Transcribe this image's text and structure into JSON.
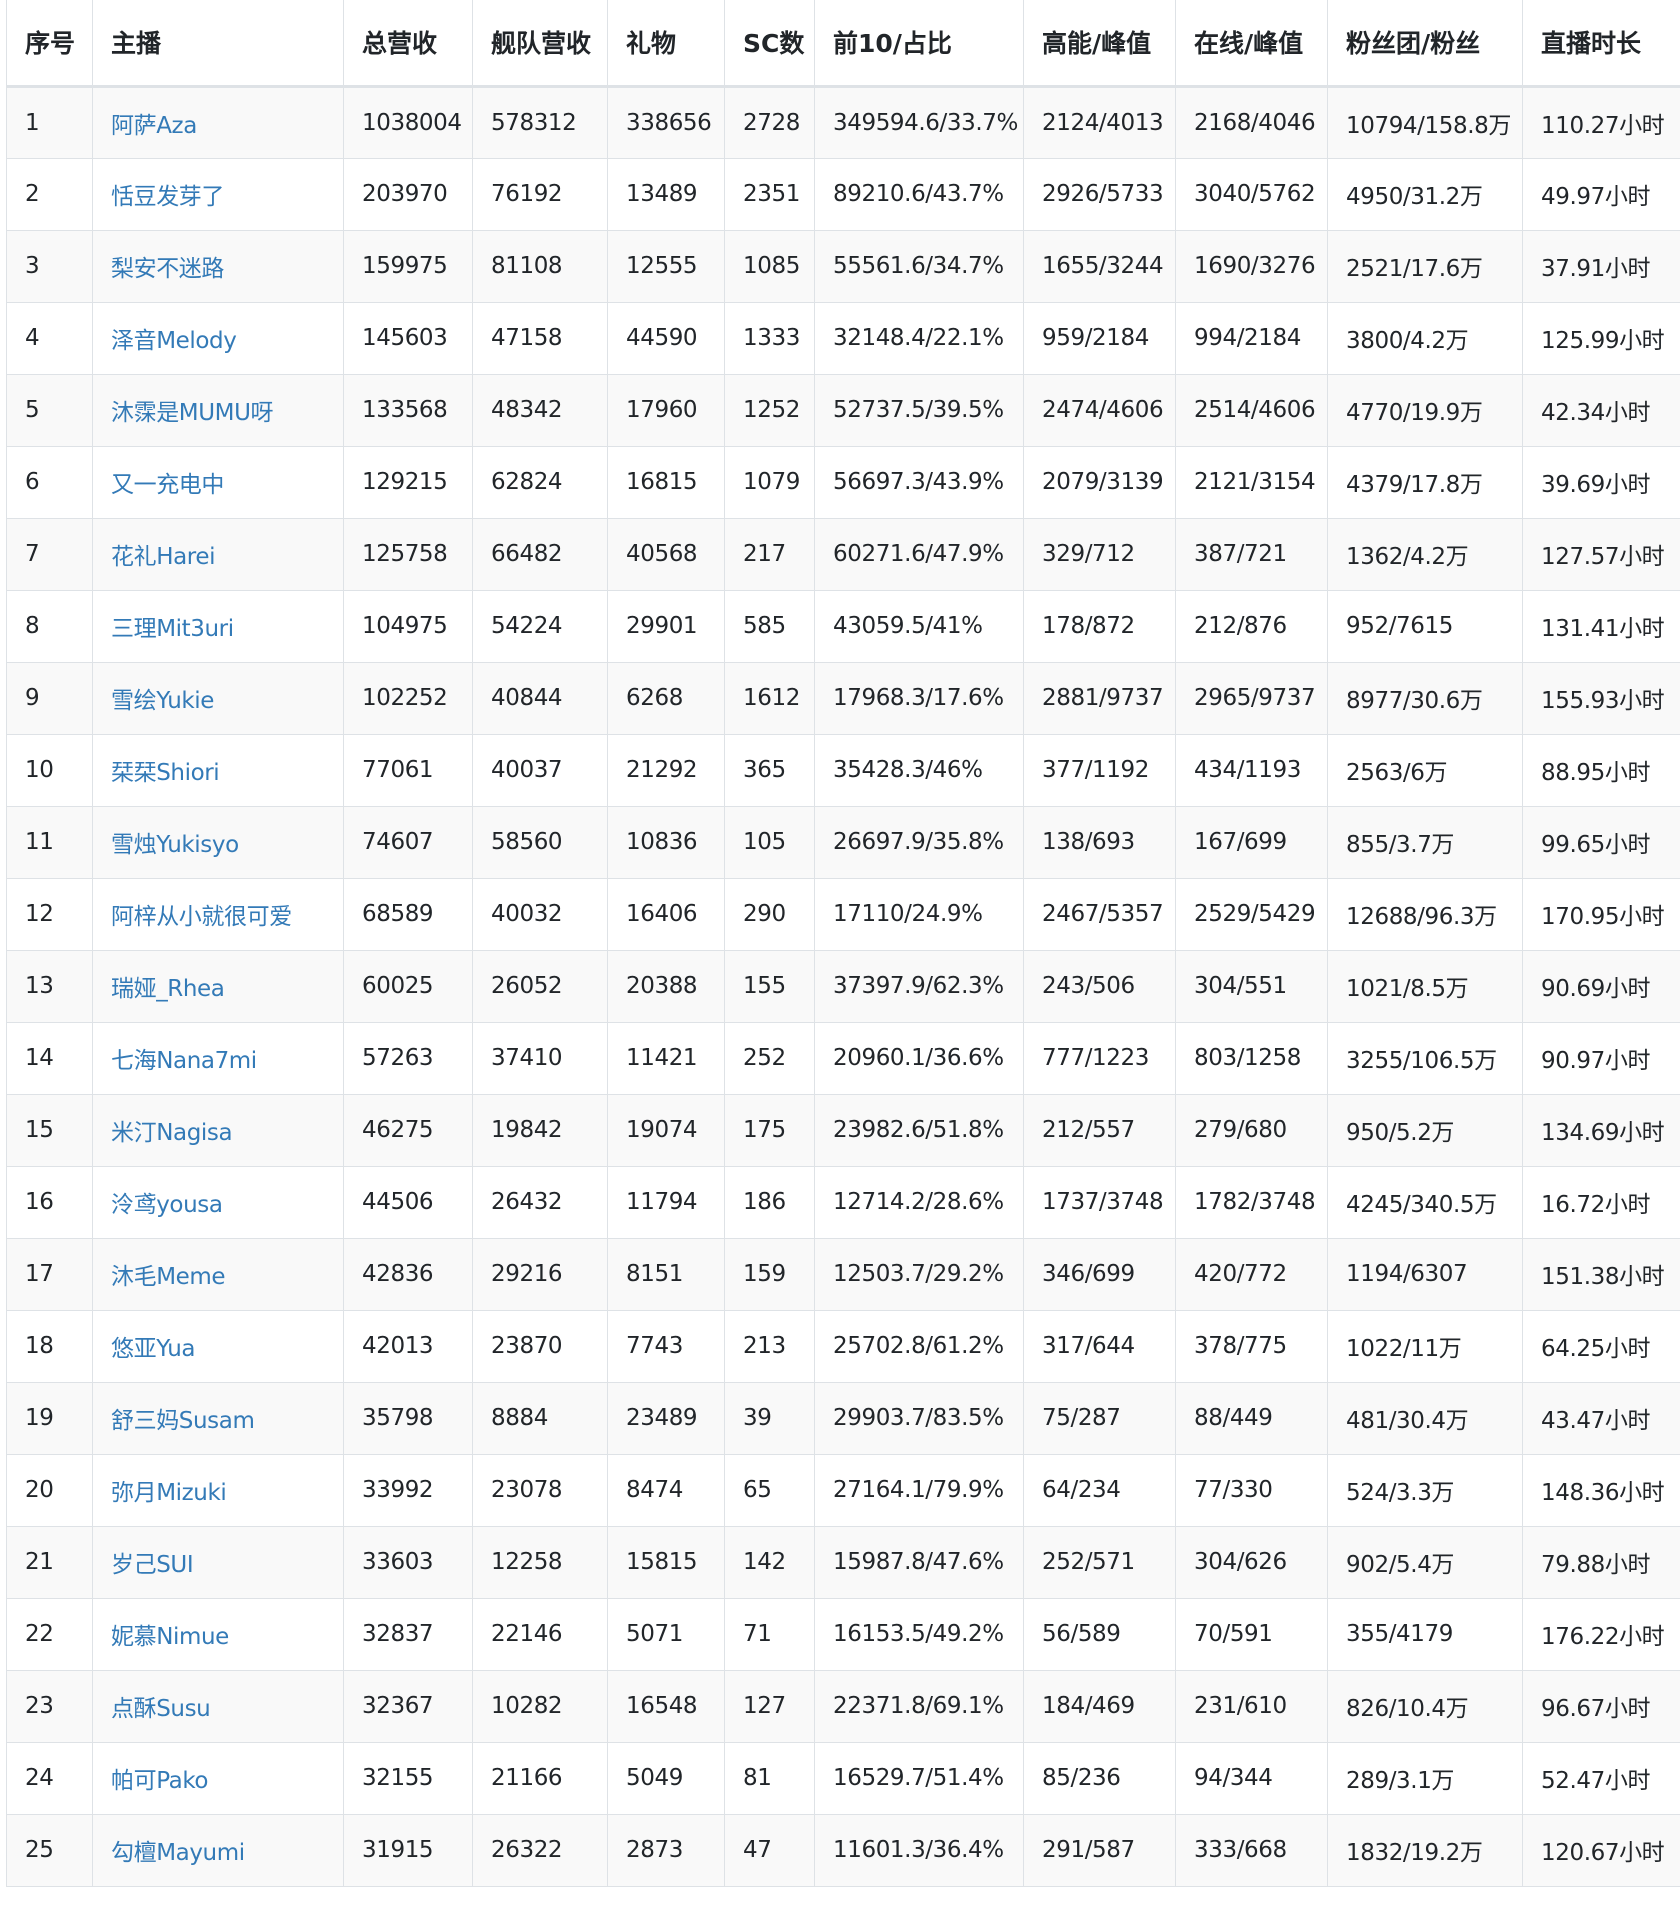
{
  "table": {
    "headers": [
      "序号",
      "主播",
      "总营收",
      "舰队营收",
      "礼物",
      "SC数",
      "前10/占比",
      "高能/峰值",
      "在线/峰值",
      "粉丝团/粉丝",
      "直播时长"
    ],
    "link_color": "#337ab7",
    "rows": [
      [
        "1",
        "阿萨Aza",
        "1038004",
        "578312",
        "338656",
        "2728",
        "349594.6/33.7%",
        "2124/4013",
        "2168/4046",
        "10794/158.8万",
        "110.27小时"
      ],
      [
        "2",
        "恬豆发芽了",
        "203970",
        "76192",
        "13489",
        "2351",
        "89210.6/43.7%",
        "2926/5733",
        "3040/5762",
        "4950/31.2万",
        "49.97小时"
      ],
      [
        "3",
        "梨安不迷路",
        "159975",
        "81108",
        "12555",
        "1085",
        "55561.6/34.7%",
        "1655/3244",
        "1690/3276",
        "2521/17.6万",
        "37.91小时"
      ],
      [
        "4",
        "泽音Melody",
        "145603",
        "47158",
        "44590",
        "1333",
        "32148.4/22.1%",
        "959/2184",
        "994/2184",
        "3800/4.2万",
        "125.99小时"
      ],
      [
        "5",
        "沐霂是MUMU呀",
        "133568",
        "48342",
        "17960",
        "1252",
        "52737.5/39.5%",
        "2474/4606",
        "2514/4606",
        "4770/19.9万",
        "42.34小时"
      ],
      [
        "6",
        "又一充电中",
        "129215",
        "62824",
        "16815",
        "1079",
        "56697.3/43.9%",
        "2079/3139",
        "2121/3154",
        "4379/17.8万",
        "39.69小时"
      ],
      [
        "7",
        "花礼Harei",
        "125758",
        "66482",
        "40568",
        "217",
        "60271.6/47.9%",
        "329/712",
        "387/721",
        "1362/4.2万",
        "127.57小时"
      ],
      [
        "8",
        "三理Mit3uri",
        "104975",
        "54224",
        "29901",
        "585",
        "43059.5/41%",
        "178/872",
        "212/876",
        "952/7615",
        "131.41小时"
      ],
      [
        "9",
        "雪绘Yukie",
        "102252",
        "40844",
        "6268",
        "1612",
        "17968.3/17.6%",
        "2881/9737",
        "2965/9737",
        "8977/30.6万",
        "155.93小时"
      ],
      [
        "10",
        "栞栞Shiori",
        "77061",
        "40037",
        "21292",
        "365",
        "35428.3/46%",
        "377/1192",
        "434/1193",
        "2563/6万",
        "88.95小时"
      ],
      [
        "11",
        "雪烛Yukisyo",
        "74607",
        "58560",
        "10836",
        "105",
        "26697.9/35.8%",
        "138/693",
        "167/699",
        "855/3.7万",
        "99.65小时"
      ],
      [
        "12",
        "阿梓从小就很可爱",
        "68589",
        "40032",
        "16406",
        "290",
        "17110/24.9%",
        "2467/5357",
        "2529/5429",
        "12688/96.3万",
        "170.95小时"
      ],
      [
        "13",
        "瑞娅_Rhea",
        "60025",
        "26052",
        "20388",
        "155",
        "37397.9/62.3%",
        "243/506",
        "304/551",
        "1021/8.5万",
        "90.69小时"
      ],
      [
        "14",
        "七海Nana7mi",
        "57263",
        "37410",
        "11421",
        "252",
        "20960.1/36.6%",
        "777/1223",
        "803/1258",
        "3255/106.5万",
        "90.97小时"
      ],
      [
        "15",
        "米汀Nagisa",
        "46275",
        "19842",
        "19074",
        "175",
        "23982.6/51.8%",
        "212/557",
        "279/680",
        "950/5.2万",
        "134.69小时"
      ],
      [
        "16",
        "泠鸢yousa",
        "44506",
        "26432",
        "11794",
        "186",
        "12714.2/28.6%",
        "1737/3748",
        "1782/3748",
        "4245/340.5万",
        "16.72小时"
      ],
      [
        "17",
        "沐毛Meme",
        "42836",
        "29216",
        "8151",
        "159",
        "12503.7/29.2%",
        "346/699",
        "420/772",
        "1194/6307",
        "151.38小时"
      ],
      [
        "18",
        "悠亚Yua",
        "42013",
        "23870",
        "7743",
        "213",
        "25702.8/61.2%",
        "317/644",
        "378/775",
        "1022/11万",
        "64.25小时"
      ],
      [
        "19",
        "舒三妈Susam",
        "35798",
        "8884",
        "23489",
        "39",
        "29903.7/83.5%",
        "75/287",
        "88/449",
        "481/30.4万",
        "43.47小时"
      ],
      [
        "20",
        "弥月Mizuki",
        "33992",
        "23078",
        "8474",
        "65",
        "27164.1/79.9%",
        "64/234",
        "77/330",
        "524/3.3万",
        "148.36小时"
      ],
      [
        "21",
        "岁己SUI",
        "33603",
        "12258",
        "15815",
        "142",
        "15987.8/47.6%",
        "252/571",
        "304/626",
        "902/5.4万",
        "79.88小时"
      ],
      [
        "22",
        "妮慕Nimue",
        "32837",
        "22146",
        "5071",
        "71",
        "16153.5/49.2%",
        "56/589",
        "70/591",
        "355/4179",
        "176.22小时"
      ],
      [
        "23",
        "点酥Susu",
        "32367",
        "10282",
        "16548",
        "127",
        "22371.8/69.1%",
        "184/469",
        "231/610",
        "826/10.4万",
        "96.67小时"
      ],
      [
        "24",
        "帕可Pako",
        "32155",
        "21166",
        "5049",
        "81",
        "16529.7/51.4%",
        "85/236",
        "94/344",
        "289/3.1万",
        "52.47小时"
      ],
      [
        "25",
        "勾檀Mayumi",
        "31915",
        "26322",
        "2873",
        "47",
        "11601.3/36.4%",
        "291/587",
        "333/668",
        "1832/19.2万",
        "120.67小时"
      ]
    ]
  }
}
